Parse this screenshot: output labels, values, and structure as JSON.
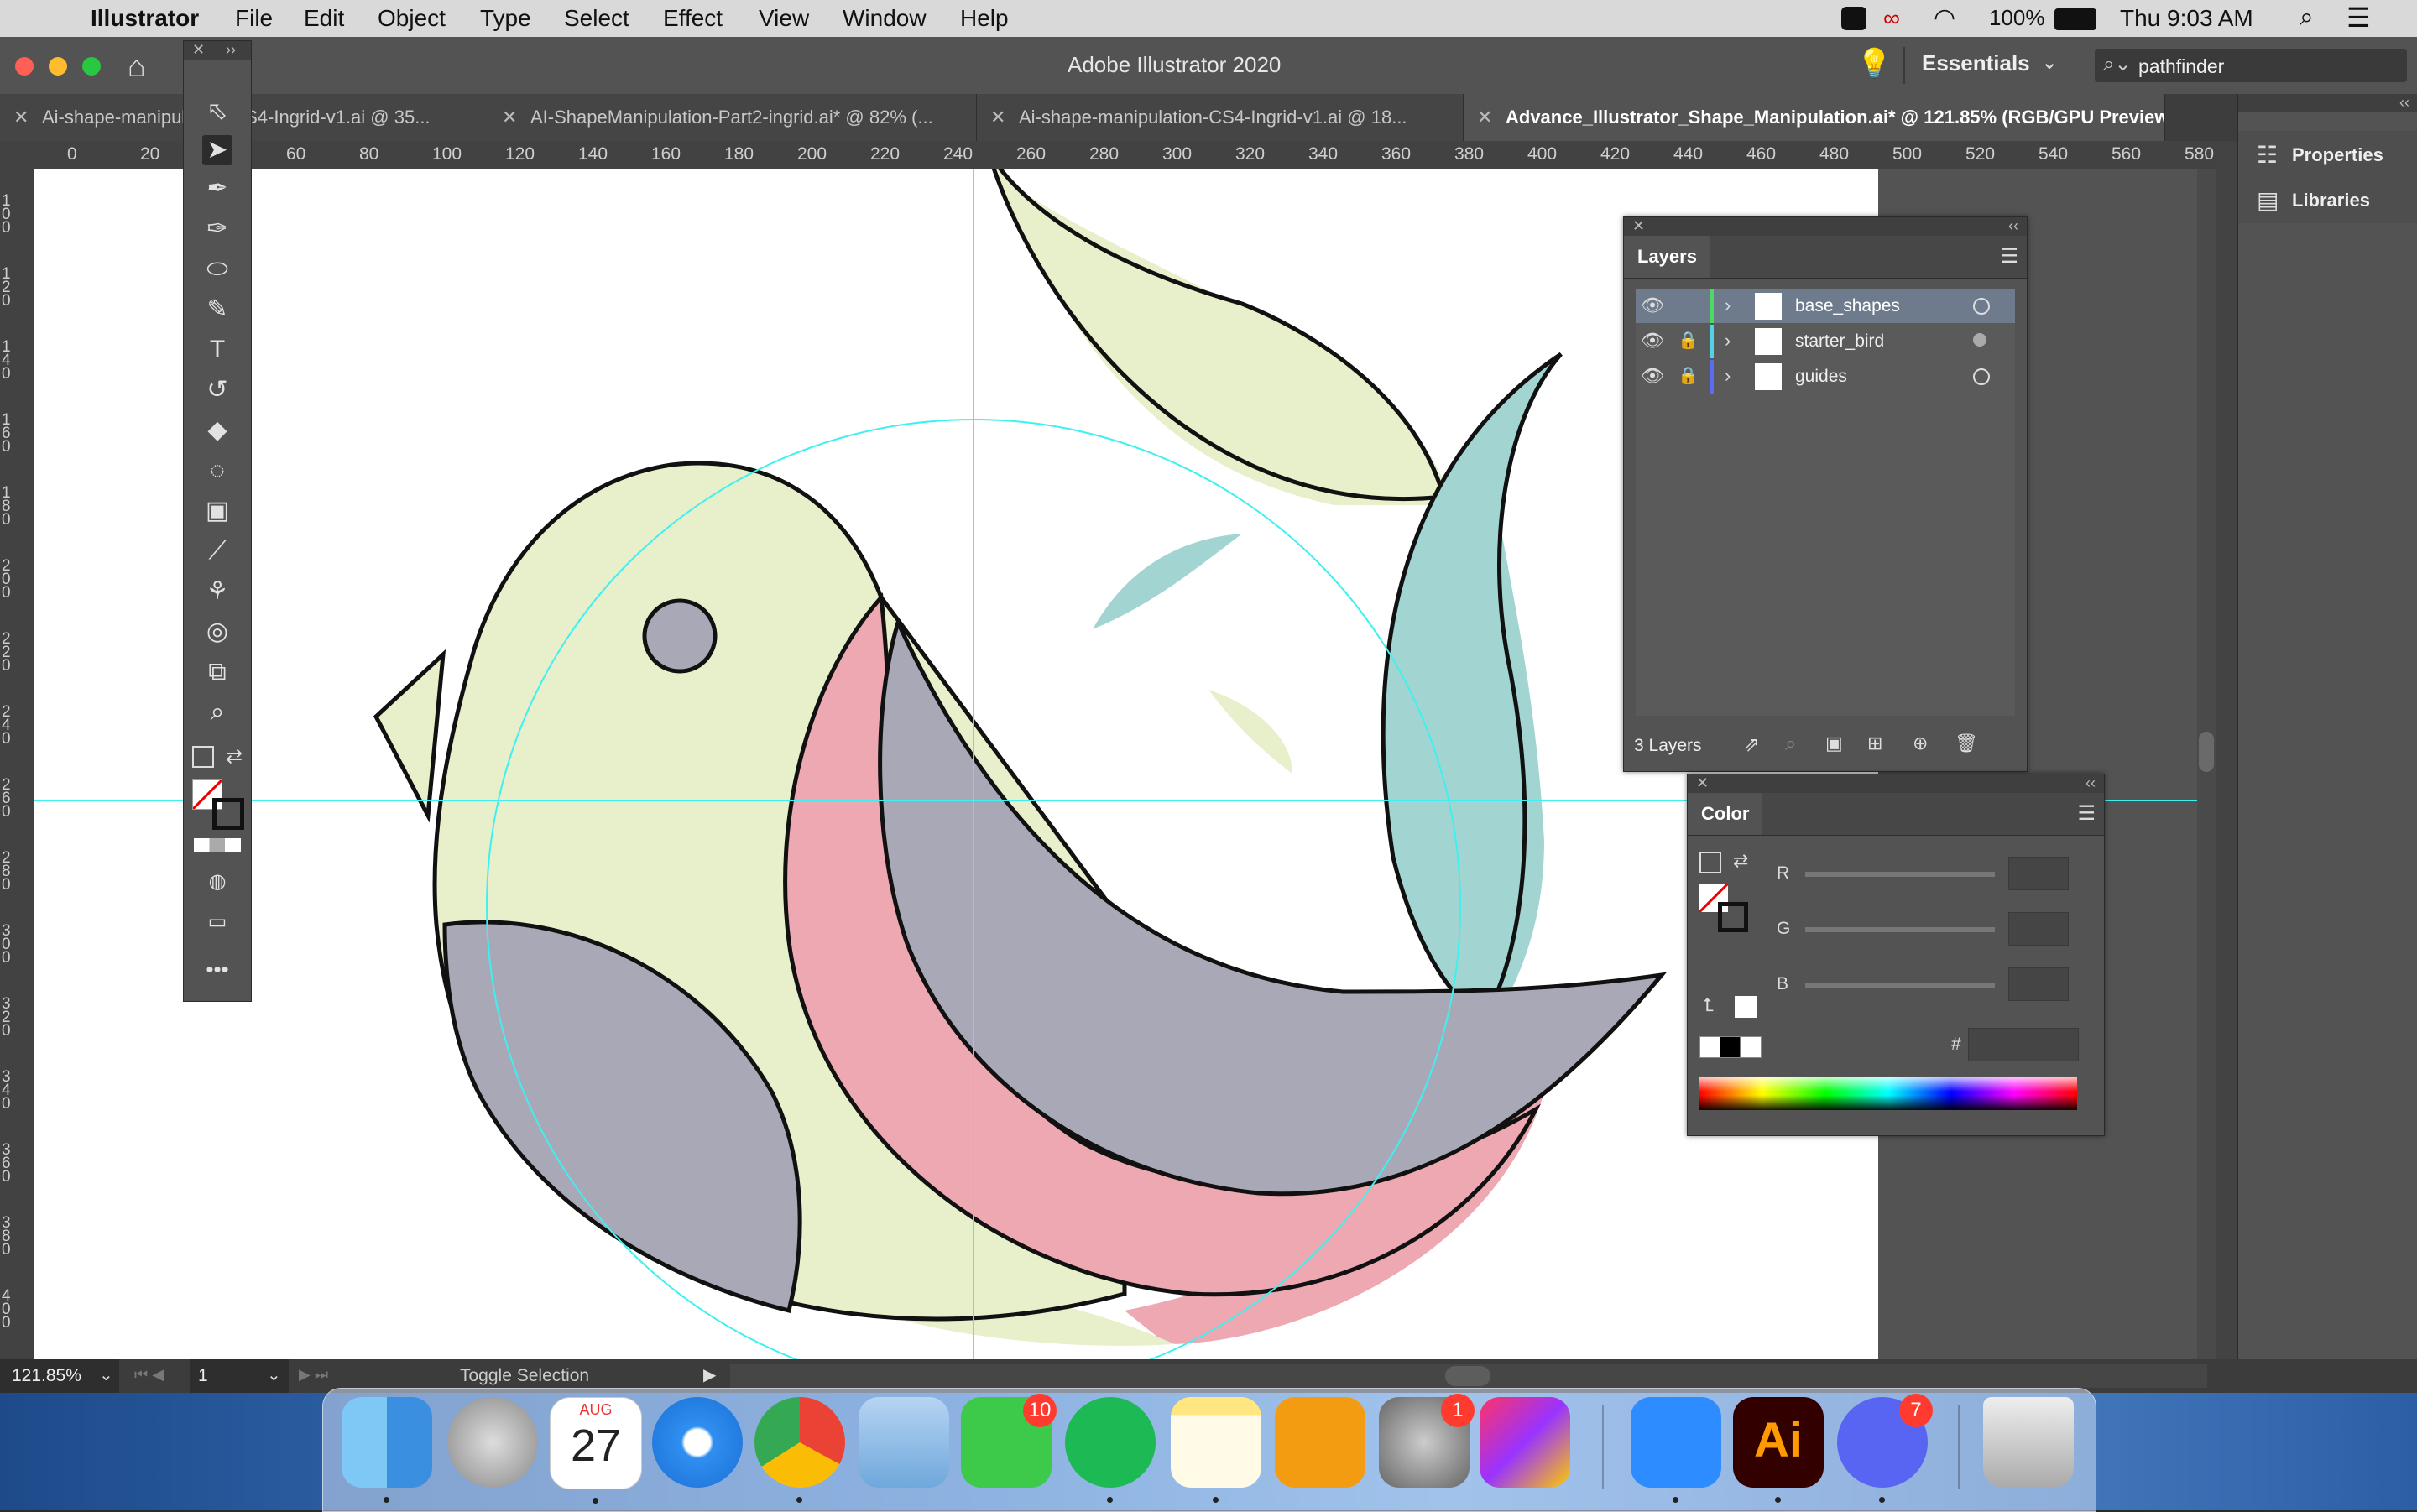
{
  "menubar": {
    "apple": "",
    "app": "Illustrator",
    "items": [
      "File",
      "Edit",
      "Object",
      "Type",
      "Select",
      "Effect",
      "View",
      "Window",
      "Help"
    ],
    "battery": "100%",
    "clock": "Thu 9:03 AM"
  },
  "titlebar": {
    "title": "Adobe Illustrator 2020",
    "workspace": "Essentials",
    "search_value": "pathfinder"
  },
  "tabs": [
    {
      "label": "Ai-shape-manipulation-CS4-Ingrid-v1.ai @ 35..."
    },
    {
      "label": "AI-ShapeManipulation-Part2-ingrid.ai* @ 82% (..."
    },
    {
      "label": "Ai-shape-manipulation-CS4-Ingrid-v1.ai @ 18..."
    },
    {
      "label": "Advance_Illustrator_Shape_Manipulation.ai* @ 121.85% (RGB/GPU Preview)"
    }
  ],
  "hruler": [
    "0",
    "20",
    "40",
    "60",
    "80",
    "100",
    "120",
    "140",
    "160",
    "180",
    "200",
    "220",
    "240",
    "260",
    "280",
    "300",
    "320",
    "340",
    "360",
    "380",
    "400",
    "420",
    "440",
    "460",
    "480",
    "500",
    "520",
    "540",
    "560",
    "580"
  ],
  "vruler": [
    "100",
    "120",
    "140",
    "160",
    "180",
    "200",
    "220",
    "240",
    "260",
    "280",
    "300",
    "320",
    "340",
    "360",
    "380",
    "400"
  ],
  "layers_panel": {
    "title": "Layers",
    "count": "3 Layers",
    "layers": [
      {
        "name": "base_shapes",
        "color": "#4cd964",
        "selected": true,
        "locked": false
      },
      {
        "name": "starter_bird",
        "color": "#4fd3e6",
        "selected": false,
        "locked": true
      },
      {
        "name": "guides",
        "color": "#5b6ef2",
        "selected": false,
        "locked": true
      }
    ]
  },
  "color_panel": {
    "title": "Color",
    "labels": {
      "r": "R",
      "g": "G",
      "b": "B",
      "hash": "#"
    }
  },
  "right_dock": {
    "properties": "Properties",
    "libraries": "Libraries"
  },
  "status": {
    "zoom": "121.85%",
    "artboard": "1",
    "tool": "Toggle Selection"
  },
  "dock": {
    "calendar_month": "AUG",
    "calendar_day": "27",
    "facetime_badge": "10",
    "prefs_badge": "1",
    "discord_badge": "7",
    "ai_label": "Ai"
  },
  "colors": {
    "bird_body": "#e8efcb",
    "bird_pink": "#eea8b2",
    "bird_gray": "#a9a8b7",
    "bird_teal": "#a2d5d1",
    "guide": "#3ff0f0"
  }
}
